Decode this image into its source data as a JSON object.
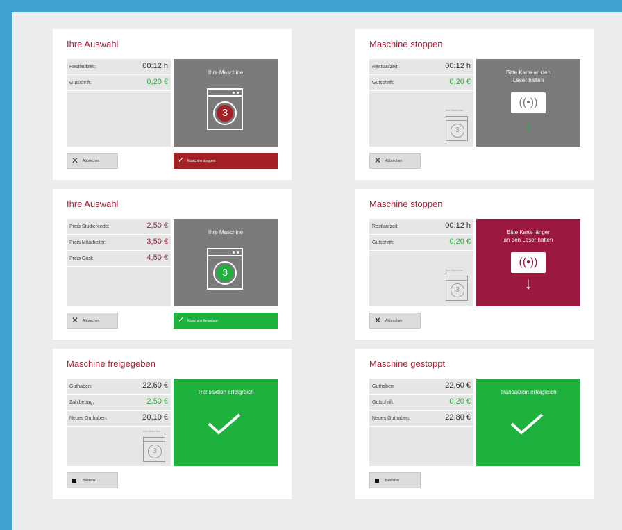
{
  "cards": [
    {
      "title": "Ihre Auswahl",
      "rows": [
        {
          "label": "Restlaufzeit:",
          "value": "00:12 h"
        },
        {
          "label": "Gutschrift:",
          "value": "0,20 €"
        }
      ],
      "panel": {
        "text": "Ihre Maschine",
        "machine_number": "3"
      },
      "cancel_label": "Abbrechen",
      "action_label": "Maschine stoppen"
    },
    {
      "title": "Maschine stoppen",
      "rows": [
        {
          "label": "Restlaufzeit:",
          "value": "00:12 h"
        },
        {
          "label": "Gutschrift:",
          "value": "0,20 €"
        }
      ],
      "mini_label": "Ihre Maschine",
      "mini_number": "3",
      "panel": {
        "text_line1": "Bitte Karte an den",
        "text_line2": "Leser halten",
        "reader": "((•))",
        "arrow": "↓"
      },
      "cancel_label": "Abbrechen"
    },
    {
      "title": "Ihre Auswahl",
      "rows": [
        {
          "label": "Preis Studierende:",
          "value": "2,50 €"
        },
        {
          "label": "Preis Mitarbeiter:",
          "value": "3,50 €"
        },
        {
          "label": "Preis Gast:",
          "value": "4,50 €"
        }
      ],
      "panel": {
        "text": "Ihre Maschine",
        "machine_number": "3"
      },
      "cancel_label": "Abbrechen",
      "action_label": "Maschine freigeben"
    },
    {
      "title": "Maschine stoppen",
      "rows": [
        {
          "label": "Restlaufzeit:",
          "value": "00:12 h"
        },
        {
          "label": "Gutschrift:",
          "value": "0,20 €"
        }
      ],
      "mini_label": "Ihre Maschine",
      "mini_number": "3",
      "panel": {
        "text_line1": "Bitte Karte länger",
        "text_line2": "an den Leser halten",
        "reader": "((•))",
        "arrow": "↓"
      },
      "cancel_label": "Abbrechen"
    },
    {
      "title": "Maschine freigegeben",
      "rows": [
        {
          "label": "Guthaben:",
          "value": "22,60 €"
        },
        {
          "label": "Zahlbetrag:",
          "value": "2,50 €"
        },
        {
          "label": "Neues Guthaben:",
          "value": "20,10 €"
        }
      ],
      "mini_label": "Ihre Maschine",
      "mini_number": "3",
      "panel": {
        "text": "Transaktion erfolgreich"
      },
      "finish_label": "Beenden"
    },
    {
      "title": "Maschine gestoppt",
      "rows": [
        {
          "label": "Guthaben:",
          "value": "22,60 €"
        },
        {
          "label": "Gutschrift:",
          "value": "0,20 €"
        },
        {
          "label": "Neues Guthaben:",
          "value": "22,80 €"
        }
      ],
      "panel": {
        "text": "Transaktion erfolgreich"
      },
      "finish_label": "Beenden"
    }
  ],
  "colors": {
    "brand_red": "#b01c38",
    "credit_green": "#2fb23b",
    "price_red": "#a3213c",
    "panel_gray": "#7b7b7b",
    "success_green": "#1fb13e",
    "warning_crimson": "#9b183e",
    "stop_red": "#a32124",
    "outer_blue": "#3ea2d3"
  }
}
